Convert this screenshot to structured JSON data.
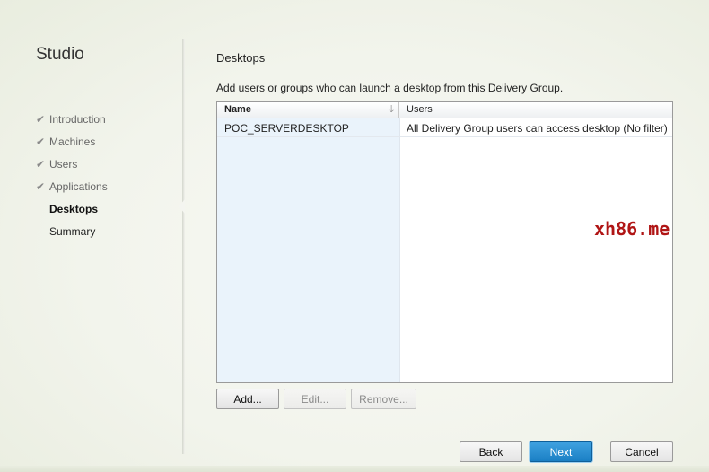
{
  "app_title": "Studio",
  "steps": [
    {
      "label": "Introduction",
      "state": "done"
    },
    {
      "label": "Machines",
      "state": "done"
    },
    {
      "label": "Users",
      "state": "done"
    },
    {
      "label": "Applications",
      "state": "done"
    },
    {
      "label": "Desktops",
      "state": "current"
    },
    {
      "label": "Summary",
      "state": "pending"
    }
  ],
  "page": {
    "title": "Desktops",
    "instruction": "Add users or groups who can launch a desktop from this Delivery Group."
  },
  "grid": {
    "columns": {
      "name": "Name",
      "users": "Users"
    },
    "sort_icon": "sort-descending-icon",
    "rows": [
      {
        "name": "POC_SERVERDESKTOP",
        "users": "All Delivery Group users can access desktop (No filter)"
      }
    ]
  },
  "actions": {
    "add": "Add...",
    "edit": "Edit...",
    "remove": "Remove..."
  },
  "footer": {
    "back": "Back",
    "next": "Next",
    "cancel": "Cancel"
  },
  "watermark": "xh86.me",
  "colors": {
    "accent": "#1a7fc4",
    "watermark": "#b01515",
    "name_column": "#eaf3fb"
  }
}
